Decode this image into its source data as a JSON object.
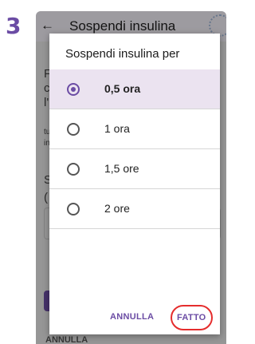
{
  "colors": {
    "accent": "#6b4ca4",
    "highlight": "#e52d2d"
  },
  "step_number": "3",
  "app_bar": {
    "title": "Sospendi insulina"
  },
  "background_partial": {
    "line1": "F",
    "line2": "c",
    "line3": "l'",
    "line4": "tu",
    "line5": "in",
    "line6": "S",
    "line7": "(",
    "bottom_button": "ANNULLA"
  },
  "dialog": {
    "title": "Sospendi insulina per",
    "options": [
      {
        "label": "0,5 ora",
        "selected": true
      },
      {
        "label": "1 ora",
        "selected": false
      },
      {
        "label": "1,5 ore",
        "selected": false
      },
      {
        "label": "2 ore",
        "selected": false
      }
    ],
    "cancel_label": "ANNULLA",
    "done_label": "FATTO"
  }
}
